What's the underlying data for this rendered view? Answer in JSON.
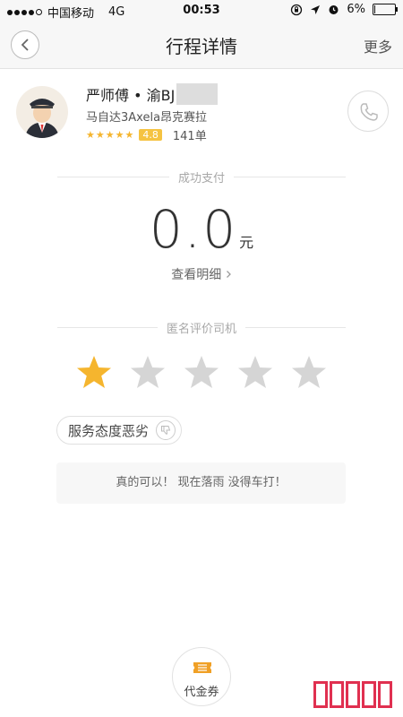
{
  "status_bar": {
    "carrier": "中国移动",
    "network": "4G",
    "time": "00:53",
    "battery": "6%",
    "battery_level": 0.06
  },
  "nav": {
    "title": "行程详情",
    "more": "更多"
  },
  "driver": {
    "name": "严师傅 • 渝BJ",
    "car": "马自达3Axela昂克赛拉",
    "rating": "4.8",
    "orders": "141单"
  },
  "payment": {
    "status": "成功支付",
    "amount": "0.0",
    "unit": "元",
    "details_link": "查看明细"
  },
  "rating": {
    "title": "匿名评价司机",
    "selected_stars": 1,
    "max_stars": 5,
    "tag": "服务态度恶劣",
    "comment": "真的可以！ 现在落雨 没得车打！"
  },
  "voucher": {
    "label": "代金券"
  },
  "colors": {
    "star_active": "#f5b52e",
    "star_inactive": "#d5d5d5",
    "voucher": "#f0a026",
    "watermark": "#e03050"
  }
}
